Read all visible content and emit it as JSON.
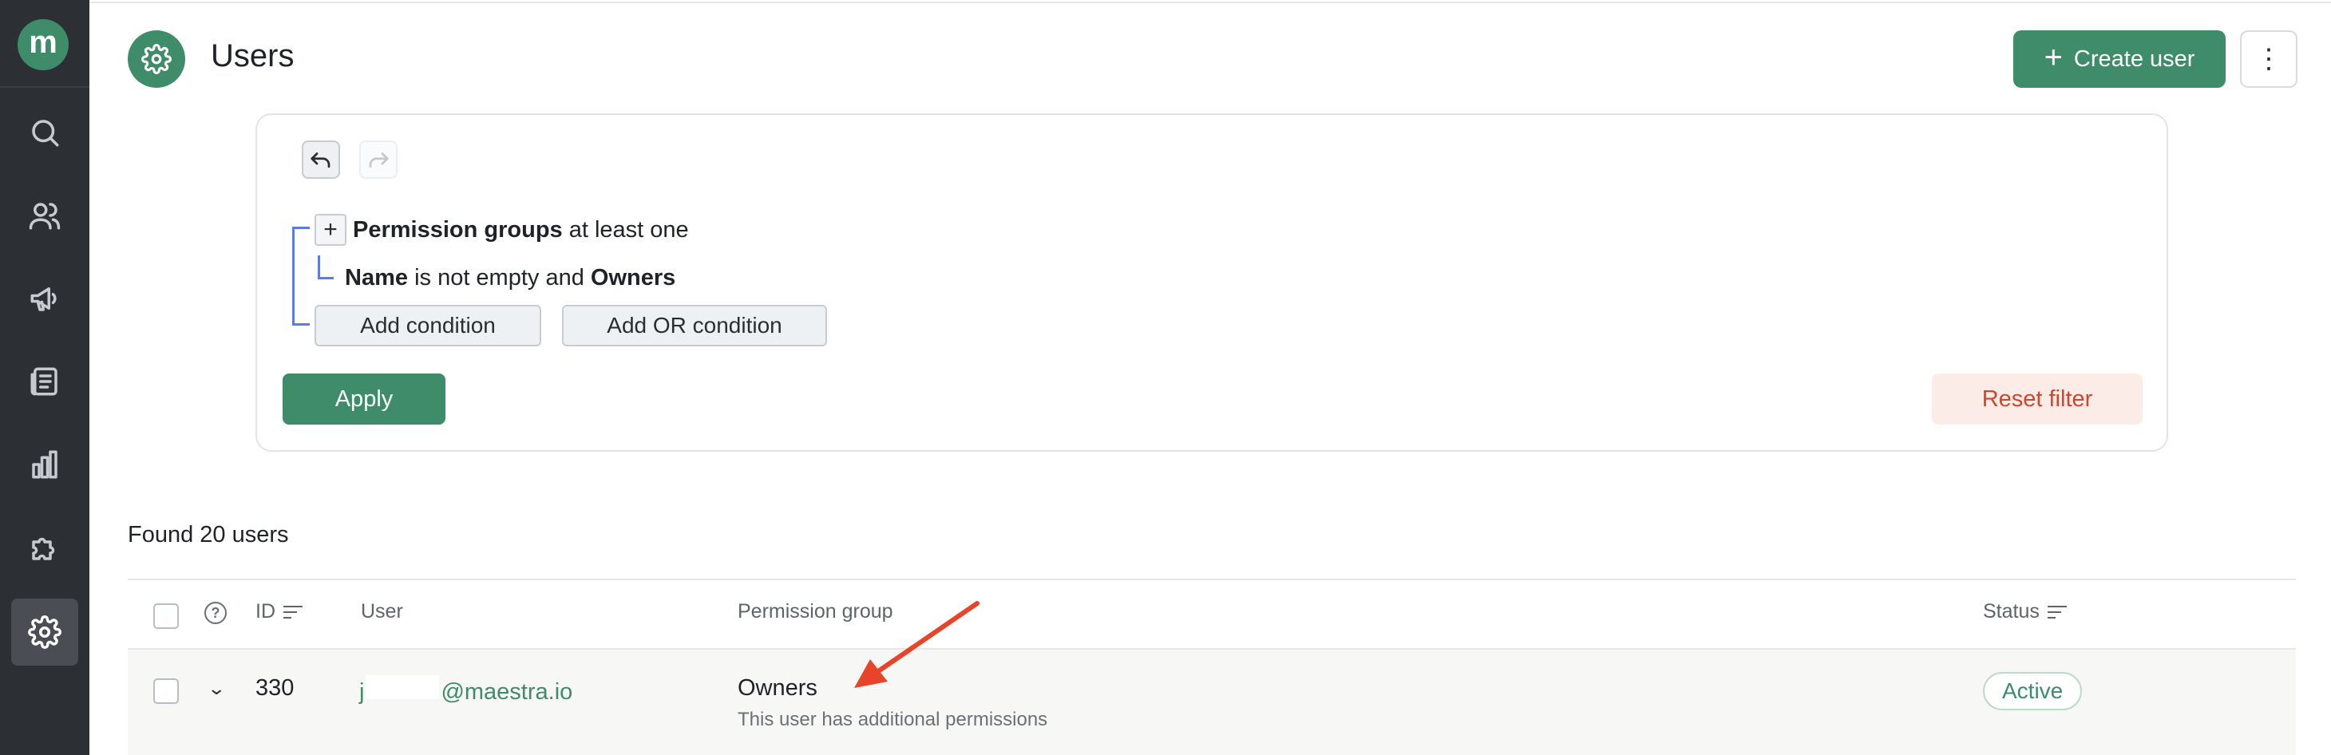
{
  "sidebar": {
    "logo_letter": "m",
    "items": [
      {
        "name": "search",
        "icon": "search-icon"
      },
      {
        "name": "users",
        "icon": "users-icon"
      },
      {
        "name": "campaigns",
        "icon": "megaphone-icon"
      },
      {
        "name": "content",
        "icon": "news-icon"
      },
      {
        "name": "analytics",
        "icon": "bar-chart-icon"
      },
      {
        "name": "integrations",
        "icon": "puzzle-icon"
      },
      {
        "name": "settings",
        "icon": "gear-icon",
        "active": true
      }
    ]
  },
  "header": {
    "title": "Users",
    "icon": "gear-icon",
    "create_button": "Create user",
    "more_icon": "⋮"
  },
  "filter": {
    "undo_icon": "undo-icon",
    "redo_icon": "redo-icon",
    "expand_symbol": "+",
    "condition1": {
      "field": "Permission groups",
      "operator": "at least one"
    },
    "condition2": {
      "field": "Name",
      "operator": "is not empty and",
      "value": "Owners"
    },
    "add_condition": "Add condition",
    "add_or_condition": "Add OR condition",
    "apply": "Apply",
    "reset": "Reset filter"
  },
  "results": {
    "found_text": "Found 20 users"
  },
  "table": {
    "columns": {
      "help": "?",
      "id": "ID",
      "user": "User",
      "permission_group": "Permission group",
      "status": "Status"
    },
    "rows": [
      {
        "expand": "⌄",
        "id": "330",
        "user_prefix": "j",
        "user_suffix": "@maestra.io",
        "permission_group": "Owners",
        "note": "This user has additional permissions",
        "status": "Active"
      }
    ]
  },
  "colors": {
    "brand_green": "#3e8c69",
    "sidebar_bg": "#2c2f33",
    "filter_bracket": "#5b7be8",
    "reset_text": "#d3452b",
    "annotation_arrow": "#e8442a"
  }
}
